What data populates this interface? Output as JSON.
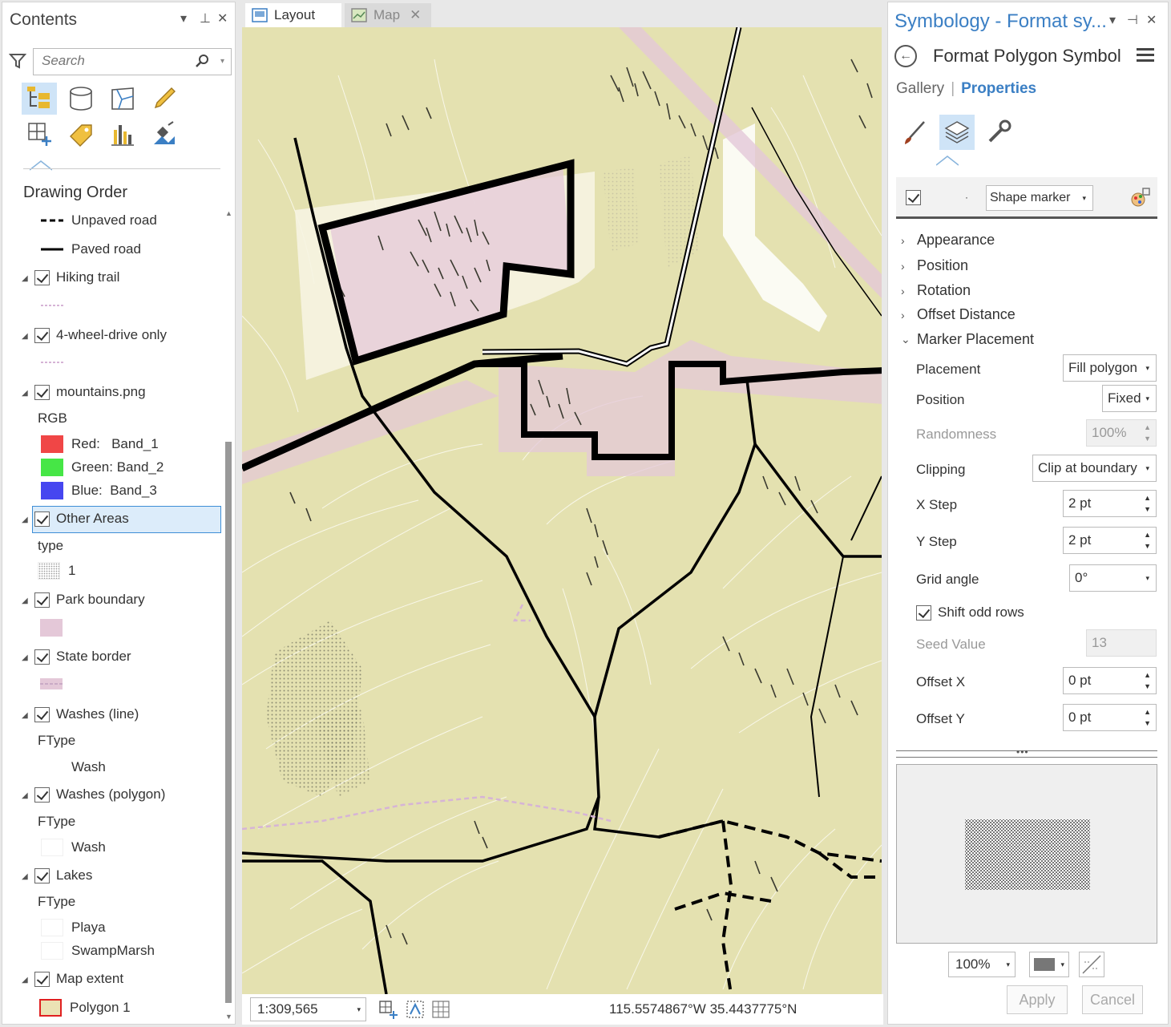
{
  "contents": {
    "title": "Contents",
    "search_placeholder": "Search",
    "section_title": "Drawing Order",
    "layers": [
      {
        "label": "Unpaved road"
      },
      {
        "label": "Paved road"
      },
      {
        "label": "Hiking trail"
      },
      {
        "label": "4-wheel-drive only"
      },
      {
        "label": "mountains.png"
      },
      {
        "label": "RGB"
      },
      {
        "label": "Red:   Band_1"
      },
      {
        "label": "Green: Band_2"
      },
      {
        "label": "Blue:  Band_3"
      },
      {
        "label": "Other Areas"
      },
      {
        "label": "type"
      },
      {
        "label": "1"
      },
      {
        "label": "Park boundary"
      },
      {
        "label": "State border"
      },
      {
        "label": "Washes (line)"
      },
      {
        "label": "FType"
      },
      {
        "label": "Wash"
      },
      {
        "label": "Washes (polygon)"
      },
      {
        "label": "FType"
      },
      {
        "label": "Wash"
      },
      {
        "label": "Lakes"
      },
      {
        "label": "FType"
      },
      {
        "label": "Playa"
      },
      {
        "label": "SwampMarsh"
      },
      {
        "label": "Map extent"
      },
      {
        "label": "Polygon 1"
      }
    ]
  },
  "map": {
    "tabs": [
      {
        "label": "Layout"
      },
      {
        "label": "Map"
      }
    ],
    "scale": "1:309,565",
    "coordinates": "115.5574867°W 35.4437775°N"
  },
  "symbology": {
    "title": "Symbology - Format sy...",
    "subtitle": "Format Polygon Symbol",
    "tab_gallery": "Gallery",
    "tab_properties": "Properties",
    "layer_marker_dot": "·",
    "marker_type": "Shape marker",
    "sections": [
      "Appearance",
      "Position",
      "Rotation",
      "Offset Distance",
      "Marker Placement"
    ],
    "props": {
      "placement_label": "Placement",
      "placement_value": "Fill polygon",
      "position_label": "Position",
      "position_value": "Fixed",
      "randomness_label": "Randomness",
      "randomness_value": "100%",
      "clipping_label": "Clipping",
      "clipping_value": "Clip at boundary",
      "xstep_label": "X Step",
      "xstep_value": "2 pt",
      "ystep_label": "Y Step",
      "ystep_value": "2 pt",
      "grid_label": "Grid angle",
      "grid_value": "0°",
      "shift_label": "Shift odd rows",
      "seed_label": "Seed Value",
      "seed_value": "13",
      "offx_label": "Offset X",
      "offx_value": "0 pt",
      "offy_label": "Offset Y",
      "offy_value": "0 pt"
    },
    "preview_zoom": "100%",
    "apply_label": "Apply",
    "cancel_label": "Cancel"
  },
  "colors": {
    "accent": "#3b7fc4",
    "selection_fill": "#dcecfa",
    "map_background": "#e4e1b0",
    "park_boundary": "#e4c8d8",
    "band_red": "#f04646",
    "band_green": "#46e646",
    "band_blue": "#4646f0",
    "map_extent_fill": "#ebe2b4",
    "map_extent_outline": "#e02020"
  }
}
